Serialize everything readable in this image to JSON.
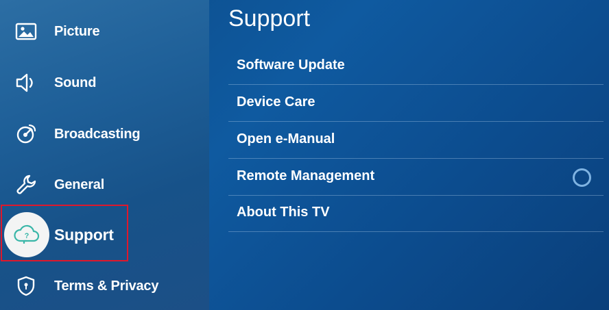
{
  "sidebar": {
    "items": [
      {
        "label": "Picture",
        "icon": "picture-icon"
      },
      {
        "label": "Sound",
        "icon": "speaker-icon"
      },
      {
        "label": "Broadcasting",
        "icon": "satellite-icon"
      },
      {
        "label": "General",
        "icon": "wrench-icon"
      },
      {
        "label": "Support",
        "icon": "cloud-question-icon",
        "selected": true
      },
      {
        "label": "Terms & Privacy",
        "icon": "shield-icon"
      }
    ]
  },
  "panel": {
    "title": "Support",
    "items": [
      {
        "label": "Software Update"
      },
      {
        "label": "Device Care"
      },
      {
        "label": "Open e-Manual"
      },
      {
        "label": "Remote Management",
        "control": "radio",
        "checked": false
      },
      {
        "label": "About This TV"
      }
    ]
  },
  "colors": {
    "highlight_border": "#e0182b",
    "focus_circle": "#f3f4f4",
    "selected_icon": "#39b6a8"
  }
}
